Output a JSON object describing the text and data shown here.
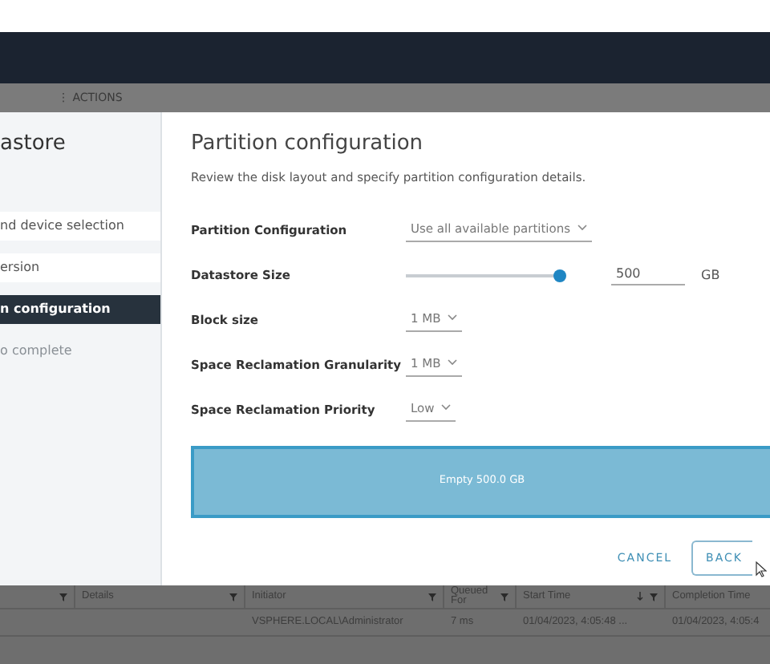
{
  "toolbar": {
    "menu_glyph": "⋮",
    "actions_label": "ACTIONS"
  },
  "wizard": {
    "title": "astore",
    "steps": [
      {
        "label": "nd device selection",
        "selected": false,
        "disabled": false
      },
      {
        "label": "ersion",
        "selected": false,
        "disabled": false
      },
      {
        "label": "n configuration",
        "selected": true,
        "disabled": false
      },
      {
        "label": "o complete",
        "selected": false,
        "disabled": true
      }
    ],
    "page_title": "Partition configuration",
    "description": "Review the disk layout and specify partition configuration details.",
    "fields": [
      {
        "kind": "select",
        "label": "Partition Configuration",
        "value": "Use all available partitions"
      },
      {
        "kind": "slider",
        "label": "Datastore Size",
        "level": 1.0,
        "value": "500",
        "unit": "GB"
      },
      {
        "kind": "select",
        "label": "Block size",
        "value": "1 MB"
      },
      {
        "kind": "select",
        "label": "Space Reclamation Granularity",
        "value": "1 MB"
      },
      {
        "kind": "select",
        "label": "Space Reclamation Priority",
        "value": "Low"
      }
    ],
    "partition_bar": {
      "label": "Empty 500.0 GB"
    },
    "buttons": [
      {
        "kind": "link",
        "label": "CANCEL"
      },
      {
        "kind": "outline",
        "label": "BACK"
      }
    ]
  },
  "table": {
    "columns": [
      {
        "kind": "filter"
      },
      {
        "kind": "filter",
        "label": "Details"
      },
      {
        "kind": "filter",
        "label": "Initiator"
      },
      {
        "kind": "filter",
        "label": "Queued For"
      },
      {
        "kind": "sortfilter",
        "label": "Start Time"
      },
      {
        "kind": "plain",
        "label": "Completion Time"
      }
    ],
    "rows": [
      [
        "",
        "",
        "VSPHERE.LOCAL\\Administrator",
        "7 ms",
        "01/04/2023, 4:05:48 ...",
        "01/04/2023, 4:05:4"
      ]
    ]
  }
}
